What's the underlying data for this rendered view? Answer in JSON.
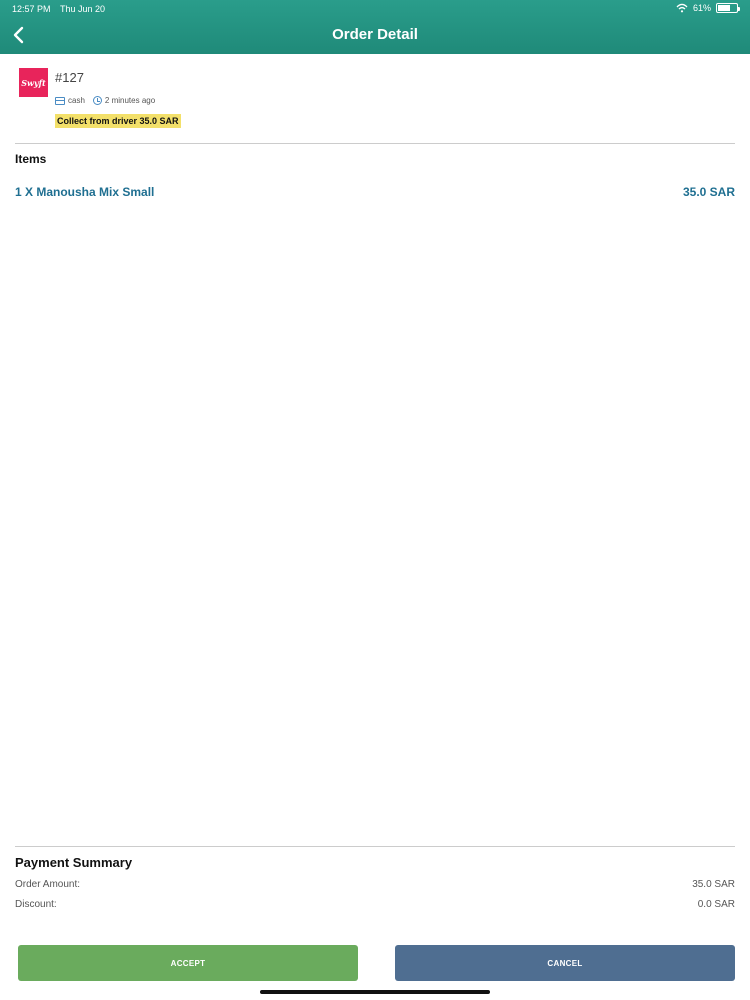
{
  "status_bar": {
    "time": "12:57 PM",
    "date": "Thu Jun 20",
    "battery": "61%"
  },
  "nav": {
    "title": "Order Detail"
  },
  "order": {
    "logo_text": "Swyft",
    "number": "#127",
    "payment_method": "cash",
    "time_ago": "2 minutes ago",
    "collect_note": "Collect from driver 35.0 SAR"
  },
  "items": {
    "title": "Items",
    "list": [
      {
        "name": "1 X Manousha Mix Small",
        "price": "35.0 SAR"
      }
    ]
  },
  "payment_summary": {
    "title": "Payment Summary",
    "rows": [
      {
        "label": "Order Amount:",
        "value": "35.0 SAR"
      },
      {
        "label": "Discount:",
        "value": "0.0 SAR"
      }
    ]
  },
  "actions": {
    "accept_label": "ACCEPT",
    "cancel_label": "CANCEL"
  },
  "colors": {
    "header": "#1f8a79",
    "accept": "#6aab5d",
    "cancel": "#4f6e91",
    "item_text": "#1f6f91",
    "highlight": "#f3e06a",
    "brand": "#e8245b"
  }
}
